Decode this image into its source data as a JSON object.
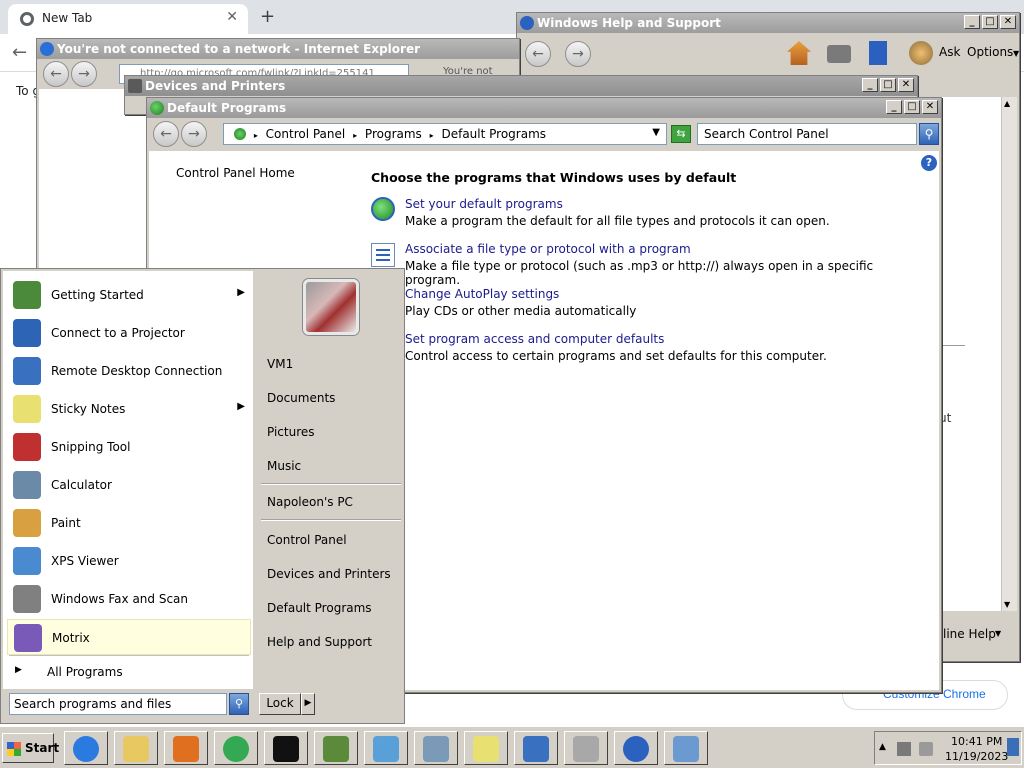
{
  "chrome": {
    "tab_title": "New Tab",
    "page_text": "To g",
    "customize_label": "Customize Chrome"
  },
  "ie": {
    "title": "You're not connected to a network - Internet Explorer",
    "address": "http://go.microsoft.com/fwlink/?LinkId=255141",
    "tab_text": "You're not"
  },
  "help": {
    "title": "Windows Help and Support",
    "ask_label": "Ask",
    "options_label": "Options",
    "online_help_label": "line Help",
    "frag_ut": "ut"
  },
  "devices": {
    "title": "Devices and Printers"
  },
  "default_programs": {
    "title": "Default Programs",
    "breadcrumb": [
      "Control Panel",
      "Programs",
      "Default Programs"
    ],
    "search_placeholder": "Search Control Panel",
    "control_panel_home": "Control Panel Home",
    "heading": "Choose the programs that Windows uses by default",
    "items": [
      {
        "link": "Set your default programs",
        "desc": "Make a program the default for all file types and protocols it can open."
      },
      {
        "link": "Associate a file type or protocol with a program",
        "desc": "Make a file type or protocol (such as .mp3 or http://) always open in a specific program."
      },
      {
        "link": "Change AutoPlay settings",
        "desc": "Play CDs or other media automatically"
      },
      {
        "link": "Set program access and computer defaults",
        "desc": "Control access to certain programs and set defaults for this computer."
      }
    ]
  },
  "start_menu": {
    "programs": [
      {
        "label": "Getting Started",
        "has_submenu": true,
        "icon": "getting-started-icon",
        "color": "#4a8a3a"
      },
      {
        "label": "Connect to a Projector",
        "has_submenu": false,
        "icon": "projector-icon",
        "color": "#2e64b5"
      },
      {
        "label": "Remote Desktop Connection",
        "has_submenu": false,
        "icon": "remote-desktop-icon",
        "color": "#3a70c0"
      },
      {
        "label": "Sticky Notes",
        "has_submenu": true,
        "icon": "sticky-notes-icon",
        "color": "#e8e070"
      },
      {
        "label": "Snipping Tool",
        "has_submenu": false,
        "icon": "snipping-tool-icon",
        "color": "#c03030"
      },
      {
        "label": "Calculator",
        "has_submenu": false,
        "icon": "calculator-icon",
        "color": "#6a8aa8"
      },
      {
        "label": "Paint",
        "has_submenu": false,
        "icon": "paint-icon",
        "color": "#d8a040"
      },
      {
        "label": "XPS Viewer",
        "has_submenu": false,
        "icon": "xps-viewer-icon",
        "color": "#4a8ad0"
      },
      {
        "label": "Windows Fax and Scan",
        "has_submenu": false,
        "icon": "fax-scan-icon",
        "color": "#808080"
      },
      {
        "label": "Motrix",
        "has_submenu": false,
        "icon": "motrix-icon",
        "color": "#7a5ab8",
        "highlight": true
      }
    ],
    "all_programs": "All Programs",
    "search_placeholder": "Search programs and files",
    "right_items": {
      "user": "VM1",
      "documents": "Documents",
      "pictures": "Pictures",
      "music": "Music",
      "computer": "Napoleon's PC",
      "control_panel": "Control Panel",
      "devices_printers": "Devices and Printers",
      "default_programs": "Default Programs",
      "help_support": "Help and Support"
    },
    "lock_label": "Lock"
  },
  "taskbar": {
    "start_label": "Start",
    "buttons": [
      {
        "name": "internet-explorer",
        "color": "#2a7ae0"
      },
      {
        "name": "file-explorer",
        "color": "#e8c860"
      },
      {
        "name": "media-player",
        "color": "#e07020"
      },
      {
        "name": "chrome",
        "color": "#34a853"
      },
      {
        "name": "command-prompt",
        "color": "#111111"
      },
      {
        "name": "minecraft",
        "color": "#5a8a3a"
      },
      {
        "name": "paper-plane",
        "color": "#5aa0d8"
      },
      {
        "name": "calculator",
        "color": "#7a9ab8"
      },
      {
        "name": "sticky-notes",
        "color": "#e8e070"
      },
      {
        "name": "remote-desktop",
        "color": "#3a70c0"
      },
      {
        "name": "fax-scan",
        "color": "#a8a8a8"
      },
      {
        "name": "help",
        "color": "#2b62c0"
      },
      {
        "name": "control-panel",
        "color": "#6a9ad0"
      }
    ],
    "time": "10:41 PM",
    "date": "11/19/2023"
  }
}
